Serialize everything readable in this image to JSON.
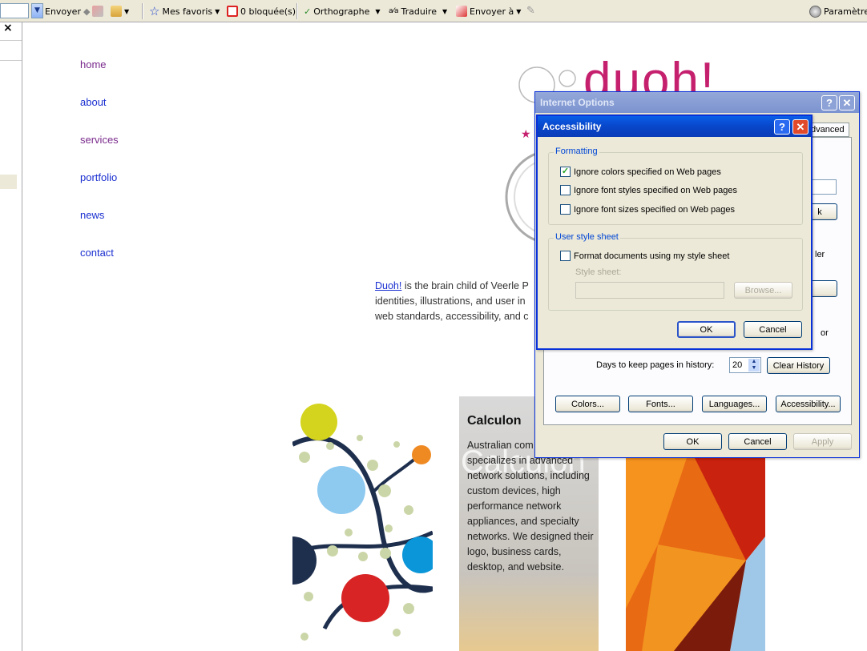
{
  "toolbar": {
    "send_label": "Envoyer",
    "favorites_label": "Mes favoris",
    "blocked_label": "0 bloquée(s)",
    "spelling_label": "Orthographe",
    "translate_label": "Traduire",
    "send_to_label": "Envoyer à",
    "settings_label": "Paramètres"
  },
  "side_panel": {
    "close_glyph": "×"
  },
  "site": {
    "nav": [
      "home",
      "about",
      "services",
      "portfolio",
      "news",
      "contact"
    ],
    "logo_text": "duoh!",
    "intro_link": "Duoh!",
    "intro_lines": [
      "is the brain child of Veerle P",
      "identities, illustrations, and user in",
      "web standards, accessibility, and c"
    ],
    "card": {
      "title": "Calculon",
      "ghost": "Calculon",
      "body": "Australian com Calculon specializes in advanced network solutions, including custom devices, high performance network appliances, and specialty networks. We designed their logo, business cards, desktop, and website."
    }
  },
  "internet_options": {
    "title": "Internet Options",
    "advanced_tab": "dvanced",
    "history_label": "Days to keep pages in history:",
    "history_days": "20",
    "clear_history": "Clear History",
    "buttons": {
      "colors": "Colors...",
      "fonts": "Fonts...",
      "languages": "Languages...",
      "accessibility": "Accessibility..."
    },
    "ok": "OK",
    "cancel": "Cancel",
    "apply": "Apply",
    "partial_k": "k",
    "partial_ler": "ler",
    "partial_or": "or"
  },
  "accessibility": {
    "title": "Accessibility",
    "formatting_group": "Formatting",
    "ignore_colors": "Ignore colors specified on Web pages",
    "ignore_colors_checked": true,
    "ignore_font_styles": "Ignore font styles specified on Web pages",
    "ignore_font_sizes": "Ignore font sizes specified on Web pages",
    "style_group": "User style sheet",
    "format_docs": "Format documents using my style sheet",
    "style_sheet_label": "Style sheet:",
    "browse": "Browse...",
    "ok": "OK",
    "cancel": "Cancel"
  },
  "colors": {
    "accent_pink": "#c5206e",
    "nav_purple": "#7a2a8c",
    "nav_blue": "#1a2fd0",
    "xp_blue": "#0a246a"
  }
}
